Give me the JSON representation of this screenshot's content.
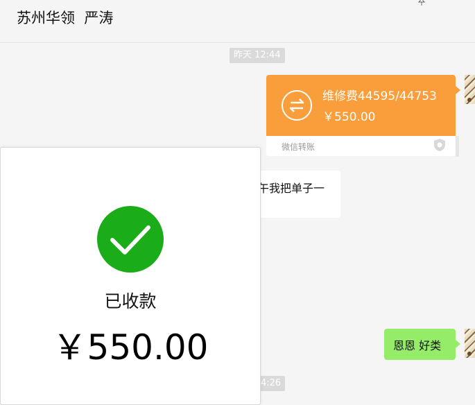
{
  "header": {
    "title": "苏州华领  严涛",
    "pin_icon": "pin-icon"
  },
  "chat": {
    "time_1": "昨天 12:44",
    "transfer": {
      "memo": "维修费44595/44753",
      "amount": "￥550.00",
      "footer": "微信转账",
      "color": "#fa9d3b",
      "icon": "transfer-arrows-icon",
      "badge_icon": "shield-icon"
    },
    "incoming_text": "午我把单子一",
    "outgoing_text": "恩恩 好类",
    "time_2": "4:26",
    "colors": {
      "outgoing_bubble": "#95ec69",
      "background": "#f5f5f5"
    }
  },
  "receipt": {
    "status": "已收款",
    "amount": "￥550.00",
    "icon": "check-circle-icon",
    "accent": "#1aad19"
  }
}
